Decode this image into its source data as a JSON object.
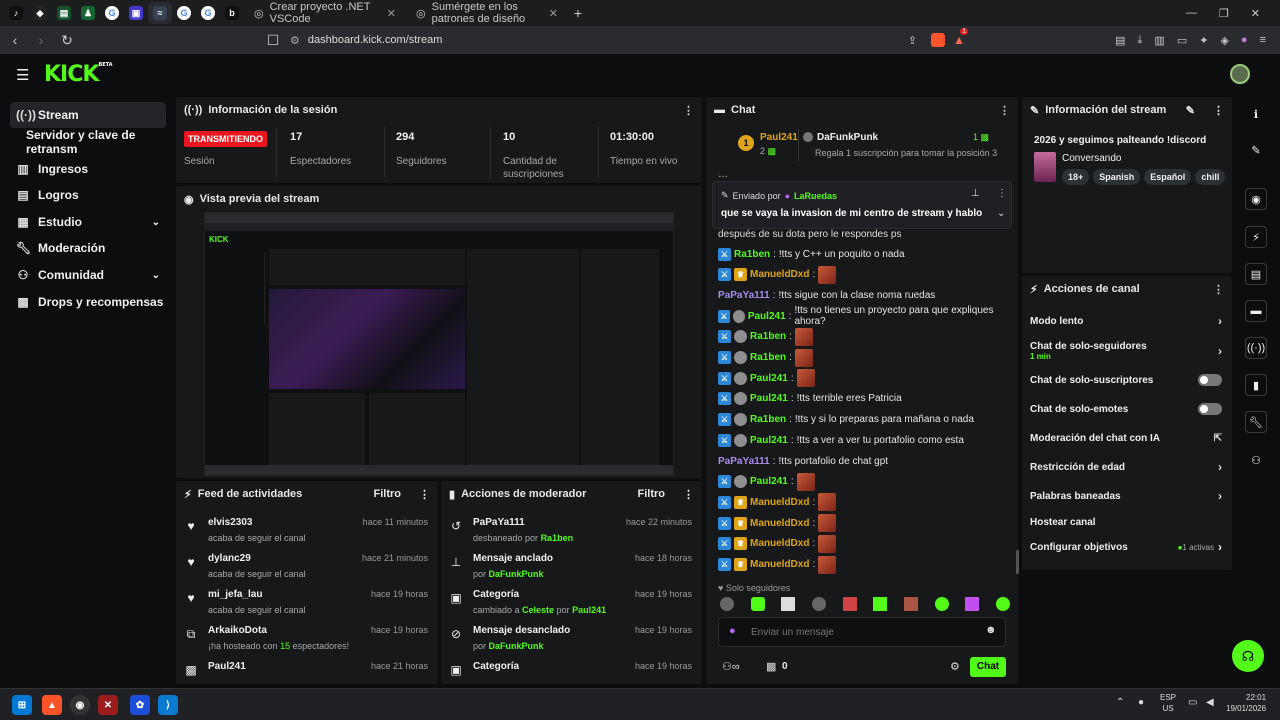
{
  "browser": {
    "tabs": [
      {
        "label": "Crear proyecto .NET VSCode"
      },
      {
        "label": "Sumérgete en los patrones de diseño"
      }
    ],
    "url": "dashboard.kick.com/stream",
    "ext_badge": "1"
  },
  "nav": {
    "logo": "KICK",
    "logo_sup": "BETA"
  },
  "sidebar": {
    "items": [
      {
        "label": "Stream",
        "icon": "stream-icon"
      },
      {
        "label": "Servidor y clave de retransm"
      },
      {
        "label": "Ingresos"
      },
      {
        "label": "Logros"
      },
      {
        "label": "Estudio"
      },
      {
        "label": "Moderación"
      },
      {
        "label": "Comunidad"
      },
      {
        "label": "Drops y recompensas"
      }
    ]
  },
  "session": {
    "title": "Información de la sesión",
    "live_badge": "TRANSMITIENDO",
    "session_label": "Sesión",
    "stats": [
      {
        "value": "17",
        "label": "Espectadores"
      },
      {
        "value": "294",
        "label": "Seguidores"
      },
      {
        "value": "10",
        "label": "Cantidad de suscripciones"
      },
      {
        "value": "01:30:00",
        "label": "Tiempo en vivo"
      }
    ]
  },
  "preview": {
    "title": "Vista previa del stream"
  },
  "feed": {
    "title": "Feed de actividades",
    "filter": "Filtro",
    "rows": [
      {
        "name": "elvis2303",
        "desc": "acaba de seguir el canal",
        "time": "hace 11 minutos"
      },
      {
        "name": "dylanc29",
        "desc": "acaba de seguir el canal",
        "time": "hace 21 minutos"
      },
      {
        "name": "mi_jefa_lau",
        "desc": "acaba de seguir el canal",
        "time": "hace 19 horas"
      },
      {
        "name": "ArkaikoDota",
        "desc_a": "¡ha hosteado con ",
        "desc_num": "15",
        "desc_b": " espectadores!",
        "time": "hace 19 horas"
      },
      {
        "name": "Paul241",
        "desc": "",
        "time": "hace 21 horas"
      }
    ]
  },
  "modactions": {
    "title": "Acciones de moderador",
    "filter": "Filtro",
    "rows": [
      {
        "name": "PaPaYa111",
        "desc": "desbaneado por ",
        "who": "Ra1ben",
        "time": "hace 22 minutos"
      },
      {
        "name": "Mensaje anclado",
        "desc": "por ",
        "who": "DaFunkPunk",
        "time": "hace 18 horas"
      },
      {
        "name": "Categoría",
        "desc": "cambiado a ",
        "who": "Celeste",
        "desc2": " por ",
        "who2": "Paul241",
        "time": "hace 19 horas"
      },
      {
        "name": "Mensaje desanclado",
        "desc": "por ",
        "who": "DaFunkPunk",
        "time": "hace 19 horas"
      },
      {
        "name": "Categoría",
        "desc": "",
        "time": "hace 19 horas"
      }
    ]
  },
  "chat": {
    "title": "Chat",
    "top_gifter": {
      "name": "Paul241",
      "count": "2",
      "rank": "1"
    },
    "top_sub": {
      "name": "DaFunkPunk",
      "count": "1",
      "prompt": "Regala 1 suscripción para tomar la posición 3"
    },
    "pinned": {
      "label": "Enviado por",
      "by": "LaRuedas",
      "message": "que se vaya la invasion de mi centro de stream y hablo"
    },
    "partial_top": "después de su dota pero le respondes ps",
    "messages": [
      {
        "user": "Ra1ben",
        "text": "!tts y C++ un poquito o nada",
        "badges": "mod",
        "color": "#53fc18"
      },
      {
        "user": "ManueldDxd",
        "text": "",
        "badges": "mod-crown",
        "color": "#e0a418",
        "emote": true
      },
      {
        "user": "PaPaYa111",
        "text": "!tts sigue con la clase noma ruedas",
        "badges": "",
        "color": "#a98cf0"
      },
      {
        "user": "Paul241",
        "text": "!tts no tienes un proyecto para que expliques ahora?",
        "badges": "mod-gift",
        "color": "#53fc18"
      },
      {
        "user": "Ra1ben",
        "text": "",
        "badges": "mod-gift",
        "color": "#53fc18",
        "emote": true
      },
      {
        "user": "Ra1ben",
        "text": "",
        "badges": "mod-gift",
        "color": "#53fc18",
        "emote": true
      },
      {
        "user": "Paul241",
        "text": "",
        "badges": "mod-gift",
        "color": "#53fc18",
        "emote": true
      },
      {
        "user": "Paul241",
        "text": "!tts terrible eres Patricia",
        "badges": "mod-gift",
        "color": "#53fc18"
      },
      {
        "user": "Ra1ben",
        "text": "!tts y si lo preparas para mañana o nada",
        "badges": "mod-gift",
        "color": "#53fc18"
      },
      {
        "user": "Paul241",
        "text": "!tts a ver a ver tu portafolio como esta",
        "badges": "mod-gift",
        "color": "#53fc18"
      },
      {
        "user": "PaPaYa111",
        "text": "!tts portafolio de chat gpt",
        "badges": "",
        "color": "#a98cf0"
      },
      {
        "user": "Paul241",
        "text": "",
        "badges": "mod-gift",
        "color": "#53fc18",
        "emote": true
      },
      {
        "user": "ManueldDxd",
        "text": "",
        "badges": "mod-crown",
        "color": "#e0a418",
        "emote": true
      },
      {
        "user": "ManueldDxd",
        "text": "",
        "badges": "mod-crown",
        "color": "#e0a418",
        "emote": true
      },
      {
        "user": "ManueldDxd",
        "text": "",
        "badges": "mod-crown",
        "color": "#e0a418",
        "emote": true
      },
      {
        "user": "ManueldDxd",
        "text": "",
        "badges": "mod-crown",
        "color": "#e0a418",
        "emote": true
      }
    ],
    "followers_only": "Solo seguidores",
    "input_placeholder": "Enviar un mensaje",
    "gift_count": "0",
    "send_label": "Chat"
  },
  "streaminfo": {
    "title": "Información del stream",
    "stream_title": "2026 y seguimos palteando !discord",
    "category": "Conversando",
    "tags": [
      "18+",
      "Spanish",
      "Español",
      "chill"
    ]
  },
  "channel": {
    "title": "Acciones de canal",
    "rows": [
      {
        "label": "Modo lento",
        "ctrl": "chevron"
      },
      {
        "label": "Chat de solo-seguidores",
        "sub": "1 min",
        "ctrl": "chevron"
      },
      {
        "label": "Chat de solo-suscriptores",
        "ctrl": "toggle"
      },
      {
        "label": "Chat de solo-emotes",
        "ctrl": "toggle"
      },
      {
        "label": "Moderación del chat con IA",
        "ctrl": "external"
      },
      {
        "label": "Restricción de edad",
        "ctrl": "chevron"
      },
      {
        "label": "Palabras baneadas",
        "ctrl": "chevron"
      },
      {
        "label": "Hostear canal",
        "ctrl": "none"
      },
      {
        "label": "Configurar objetivos",
        "extra": "1 activas",
        "ctrl": "chevron"
      }
    ]
  },
  "taskbar": {
    "lang": "ESP",
    "region": "US",
    "time": "22:01",
    "date": "19/01/2026"
  },
  "colors": {
    "accent": "#53fc18",
    "live": "#e9161f",
    "panel": "#16181a",
    "bg": "#0b0d0e"
  }
}
